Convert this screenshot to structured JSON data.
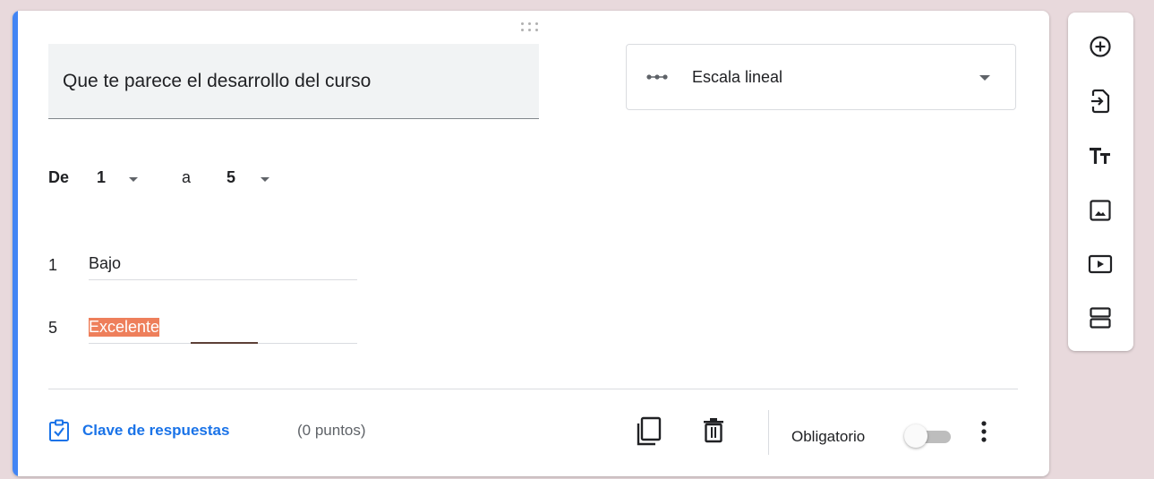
{
  "question": {
    "title": "Que te parece el desarrollo del curso",
    "type_label": "Escala lineal",
    "type_icon": "linear-scale-icon"
  },
  "scale": {
    "from_label": "De",
    "min_value": "1",
    "to_label": "a",
    "max_value": "5",
    "labels": [
      {
        "number": "1",
        "text": "Bajo"
      },
      {
        "number": "5",
        "text": "Excelente"
      }
    ]
  },
  "footer": {
    "answer_key_label": "Clave de respuestas",
    "points": "(0 puntos)",
    "required_label": "Obligatorio",
    "required_on": false
  },
  "toolbar": {
    "items": [
      "add-question-icon",
      "import-questions-icon",
      "add-title-icon",
      "add-image-icon",
      "add-video-icon",
      "add-section-icon"
    ]
  },
  "colors": {
    "accent": "#4285f4",
    "link": "#1a73e8",
    "selection": "#ee7f5b",
    "background": "#e8d9dc"
  }
}
